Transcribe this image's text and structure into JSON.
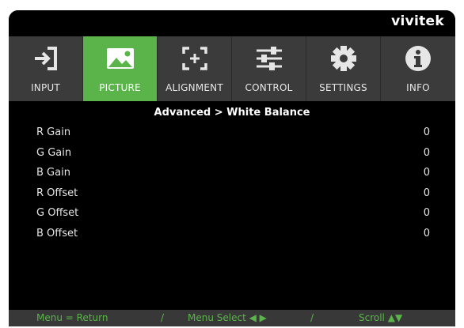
{
  "brand": "vivitek",
  "tabs": [
    {
      "label": "INPUT",
      "icon": "input-icon",
      "active": false
    },
    {
      "label": "PICTURE",
      "icon": "picture-icon",
      "active": true
    },
    {
      "label": "ALIGNMENT",
      "icon": "alignment-icon",
      "active": false
    },
    {
      "label": "CONTROL",
      "icon": "control-icon",
      "active": false
    },
    {
      "label": "SETTINGS",
      "icon": "settings-icon",
      "active": false
    },
    {
      "label": "INFO",
      "icon": "info-icon",
      "active": false
    }
  ],
  "breadcrumb": "Advanced > White Balance",
  "rows": [
    {
      "name": "R Gain",
      "value": "0"
    },
    {
      "name": "G Gain",
      "value": "0"
    },
    {
      "name": "B Gain",
      "value": "0"
    },
    {
      "name": "R Offset",
      "value": "0"
    },
    {
      "name": "G Offset",
      "value": "0"
    },
    {
      "name": "B Offset",
      "value": "0"
    }
  ],
  "footer": {
    "menu_return": "Menu = Return",
    "sep1": "/",
    "menu_select": "Menu Select ◀ ▶",
    "sep2": "/",
    "scroll": "Scroll ▲▼"
  },
  "colors": {
    "accent": "#5ab44a",
    "tabbar": "#3b3b3b",
    "footer": "#383838"
  }
}
